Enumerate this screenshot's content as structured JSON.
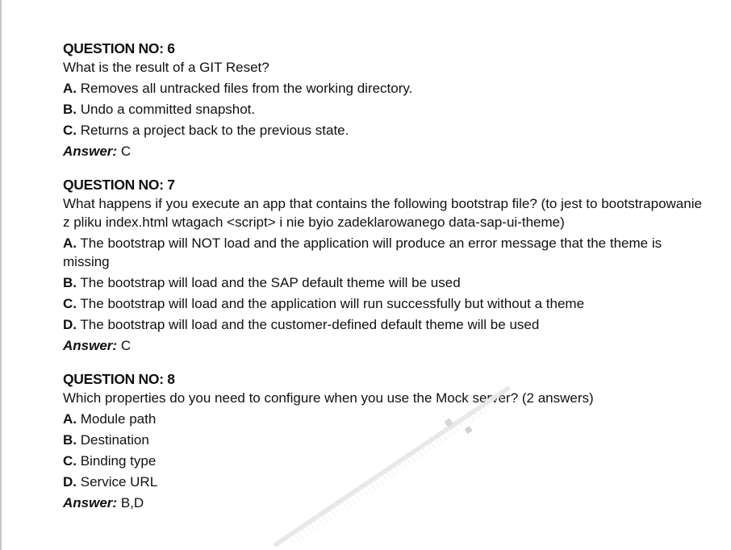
{
  "document": {
    "questions": [
      {
        "title": "QUESTION NO: 6",
        "text": "What is the result of a GIT Reset?",
        "options": [
          {
            "letter": "A.",
            "text": "Removes all untracked files from the working directory."
          },
          {
            "letter": "B.",
            "text": "Undo a committed snapshot."
          },
          {
            "letter": "C.",
            "text": "Returns a project back to the previous state."
          }
        ],
        "answer_label": "Answer:",
        "answer": "C"
      },
      {
        "title": "QUESTION NO: 7",
        "text": "What happens if you execute an app that contains the following bootstrap file? (to jest to bootstrapowanie z pliku index.html wtagach <script> i nie byio zadeklarowanego data-sap-ui-theme)",
        "options": [
          {
            "letter": "A.",
            "text": "The bootstrap will NOT load and the application will produce an error message that the theme is missing"
          },
          {
            "letter": "B.",
            "text": "The bootstrap will load and the SAP default theme will be used"
          },
          {
            "letter": "C.",
            "text": "The bootstrap will load and the application will run successfully but without a theme"
          },
          {
            "letter": "D.",
            "text": "The bootstrap will load and the customer-defined default theme will be used"
          }
        ],
        "answer_label": "Answer:",
        "answer": "C"
      },
      {
        "title": "QUESTION NO: 8",
        "text": "Which properties do you need to configure when you use the Mock server? (2 answers)",
        "options": [
          {
            "letter": "A.",
            "text": "Module path"
          },
          {
            "letter": "B.",
            "text": "Destination"
          },
          {
            "letter": "C.",
            "text": "Binding type"
          },
          {
            "letter": "D.",
            "text": "Service URL"
          }
        ],
        "answer_label": "Answer:",
        "answer": "B,D"
      }
    ]
  },
  "colors": {
    "text": "#111111",
    "background": "#ffffff",
    "page_edge": "#c8c8c8",
    "watermark": "#e6e6e6"
  }
}
